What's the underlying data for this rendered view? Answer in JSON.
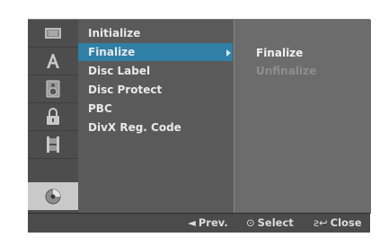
{
  "menu": {
    "items": [
      {
        "label": "Initialize"
      },
      {
        "label": "Finalize",
        "selected": true,
        "has_submenu": true
      },
      {
        "label": "Disc Label"
      },
      {
        "label": "Disc Protect"
      },
      {
        "label": "PBC"
      },
      {
        "label": "DivX Reg. Code"
      }
    ]
  },
  "submenu": {
    "items": [
      {
        "label": "Finalize",
        "enabled": true
      },
      {
        "label": "Unfinalize",
        "enabled": false
      }
    ]
  },
  "categories": [
    {
      "icon": "film-icon"
    },
    {
      "icon": "language-a-icon"
    },
    {
      "icon": "speaker-icon"
    },
    {
      "icon": "lock-icon"
    },
    {
      "icon": "filmstrip-icon"
    },
    {
      "icon": "disc-icon",
      "active": true
    }
  ],
  "footer": {
    "prev": {
      "symbol": "◄",
      "label": "Prev."
    },
    "select": {
      "symbol": "⊙",
      "label": "Select"
    },
    "close": {
      "symbol": "ƨ↩",
      "label": "Close"
    }
  },
  "colors": {
    "selection": "#2f7fa6",
    "panel": "#5a5a5a",
    "submenu_panel": "#6c6c6c",
    "active_category": "#c9c9c9"
  }
}
